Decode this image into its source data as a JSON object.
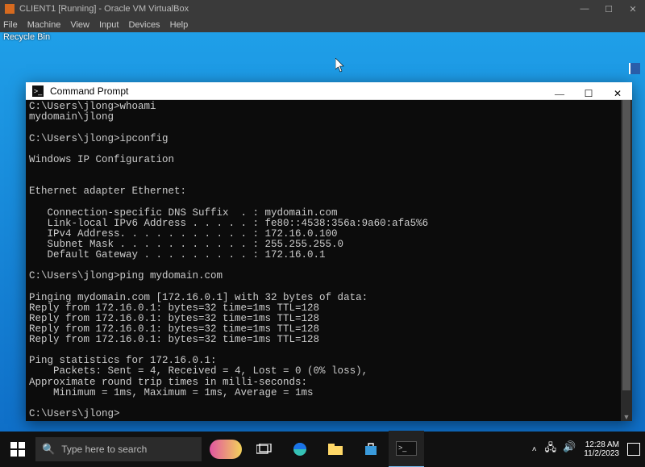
{
  "vbox": {
    "title": "CLIENT1 [Running] - Oracle VM VirtualBox",
    "menu": [
      "File",
      "Machine",
      "View",
      "Input",
      "Devices",
      "Help"
    ]
  },
  "desktop": {
    "recycle_label": "Recycle Bin"
  },
  "cmd_window": {
    "title": "Command Prompt",
    "lines": [
      "C:\\Users\\jlong>whoami",
      "mydomain\\jlong",
      "",
      "C:\\Users\\jlong>ipconfig",
      "",
      "Windows IP Configuration",
      "",
      "",
      "Ethernet adapter Ethernet:",
      "",
      "   Connection-specific DNS Suffix  . : mydomain.com",
      "   Link-local IPv6 Address . . . . . : fe80::4538:356a:9a60:afa5%6",
      "   IPv4 Address. . . . . . . . . . . : 172.16.0.100",
      "   Subnet Mask . . . . . . . . . . . : 255.255.255.0",
      "   Default Gateway . . . . . . . . . : 172.16.0.1",
      "",
      "C:\\Users\\jlong>ping mydomain.com",
      "",
      "Pinging mydomain.com [172.16.0.1] with 32 bytes of data:",
      "Reply from 172.16.0.1: bytes=32 time=1ms TTL=128",
      "Reply from 172.16.0.1: bytes=32 time=1ms TTL=128",
      "Reply from 172.16.0.1: bytes=32 time=1ms TTL=128",
      "Reply from 172.16.0.1: bytes=32 time=1ms TTL=128",
      "",
      "Ping statistics for 172.16.0.1:",
      "    Packets: Sent = 4, Received = 4, Lost = 0 (0% loss),",
      "Approximate round trip times in milli-seconds:",
      "    Minimum = 1ms, Maximum = 1ms, Average = 1ms",
      "",
      "C:\\Users\\jlong>"
    ]
  },
  "taskbar": {
    "search_placeholder": "Type here to search",
    "time": "12:28 AM",
    "date": "11/2/2023"
  }
}
